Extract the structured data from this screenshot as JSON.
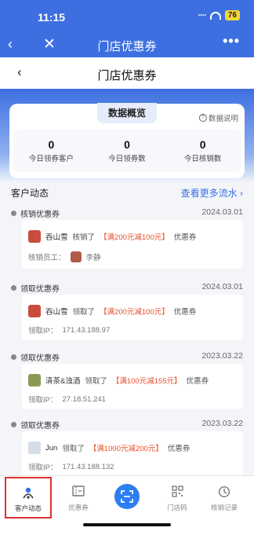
{
  "status": {
    "time": "11:15",
    "battery": "76"
  },
  "topbar": {
    "title": "门店优惠券",
    "back": "‹",
    "close": "✕",
    "more": "•••"
  },
  "subheader": {
    "title": "门店优惠券",
    "back": "‹"
  },
  "overview": {
    "title": "数据概览",
    "help": "数据说明",
    "stats": [
      {
        "value": "0",
        "label": "今日领券客户"
      },
      {
        "value": "0",
        "label": "今日领券数"
      },
      {
        "value": "0",
        "label": "今日核销数"
      }
    ]
  },
  "activity": {
    "title": "客户动态",
    "more": "查看更多流水 ›",
    "entries": [
      {
        "type": "核销优惠券",
        "date": "2024.03.01",
        "user": "吞山雪",
        "action": "核销了",
        "coupon": "【满200元减100元】",
        "suffix": "优惠券",
        "extra_label": "核销员工：",
        "extra_value": "李静",
        "avatar_color": "#c94d3f"
      },
      {
        "type": "领取优惠券",
        "date": "2024.03.01",
        "user": "吞山雪",
        "action": "领取了",
        "coupon": "【满200元减100元】",
        "suffix": "优惠券",
        "extra_label": "领取IP：",
        "extra_value": "171.43.188.97",
        "avatar_color": "#c94d3f"
      },
      {
        "type": "领取优惠券",
        "date": "2023.03.22",
        "user": "清茶&浊酒",
        "action": "领取了",
        "coupon": "【满100元减155元】",
        "suffix": "优惠券",
        "extra_label": "领取IP：",
        "extra_value": "27.18.51.241",
        "avatar_color": "#8a9a56"
      },
      {
        "type": "领取优惠券",
        "date": "2023.03.22",
        "user": "Jun",
        "action": "领取了",
        "coupon": "【满1000元减200元】",
        "suffix": "优惠券",
        "extra_label": "领取IP：",
        "extra_value": "171.43.188.132",
        "avatar_color": "#d6dde8"
      }
    ]
  },
  "bottomnav": {
    "items": [
      {
        "label": "客户动态",
        "icon": "person-pin-icon"
      },
      {
        "label": "优惠券",
        "icon": "coupon-icon"
      },
      {
        "label": "",
        "icon": "scan-icon"
      },
      {
        "label": "门店码",
        "icon": "qrcode-icon"
      },
      {
        "label": "核销记录",
        "icon": "history-icon"
      }
    ]
  },
  "colors": {
    "primary": "#3d6fe0",
    "accent": "#e94f2a",
    "highlight": "#e0302f"
  }
}
